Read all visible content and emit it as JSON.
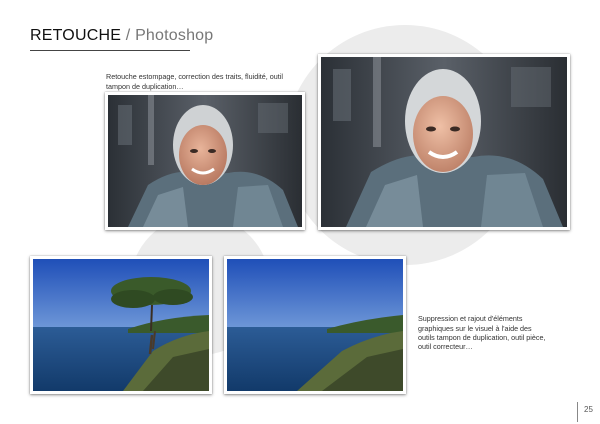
{
  "header": {
    "title_main": "RETOUCHE",
    "title_separator": "/",
    "title_sub": "Photoshop"
  },
  "captions": {
    "portrait": "Retouche estompage, correction des traits, fluidité, outil tampon de duplication…",
    "landscape": "Suppression et rajout d'éléments graphiques sur le visuel à l'aide des outils tampon de duplication, outil pièce, outil correcteur…"
  },
  "footer": {
    "page_number": "25"
  },
  "colors": {
    "background": "#ffffff",
    "decor_circle": "#ececec",
    "sky": "#2f5fbf",
    "sea": "#1e4f8a",
    "portrait_bg": "#3a4048"
  },
  "images": {
    "portrait_before": "portrait-photo",
    "portrait_after": "portrait-photo",
    "landscape_before": "seascape-photo-with-tree",
    "landscape_after": "seascape-photo-without-tree"
  }
}
